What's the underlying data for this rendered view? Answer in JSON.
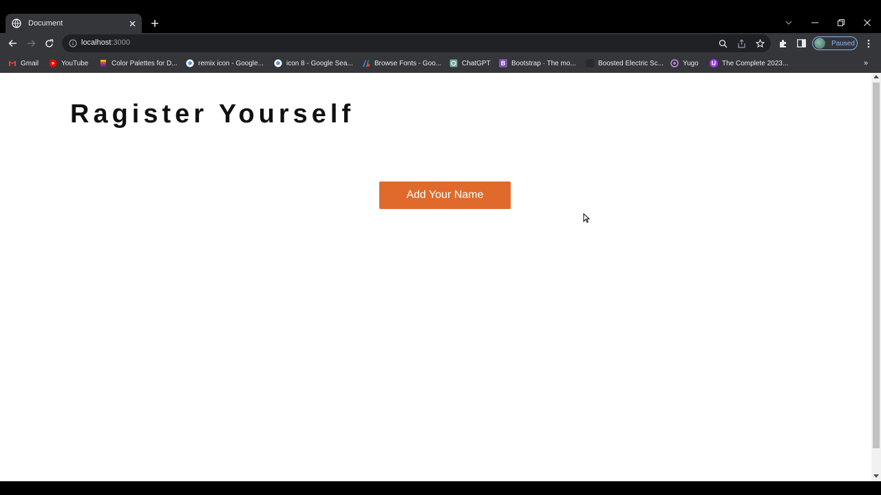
{
  "browser": {
    "tab": {
      "title": "Document",
      "favicon": "globe-icon"
    },
    "address": {
      "host": "localhost",
      "port": ":3000"
    },
    "profile": {
      "status": "Paused"
    },
    "bookmarks": [
      {
        "label": "Gmail",
        "icon": "gmail-icon",
        "color": "#ea4335"
      },
      {
        "label": "YouTube",
        "icon": "youtube-icon",
        "color": "#ff0000"
      },
      {
        "label": "Color Palettes for D...",
        "icon": "palette-icon",
        "color": "#f4b400"
      },
      {
        "label": "remix icon - Google...",
        "icon": "google-icon",
        "color": "#ffffff"
      },
      {
        "label": "icon 8 - Google Sea...",
        "icon": "google-icon",
        "color": "#ffffff"
      },
      {
        "label": "Browse Fonts - Goo...",
        "icon": "fonts-icon",
        "color": "#4285f4"
      },
      {
        "label": "ChatGPT",
        "icon": "chatgpt-icon",
        "color": "#74aa9c"
      },
      {
        "label": "Bootstrap · The mo...",
        "icon": "bootstrap-icon",
        "color": "#7952b3"
      },
      {
        "label": "Boosted Electric Sc...",
        "icon": "boosted-icon",
        "color": "#222222"
      },
      {
        "label": "Yugo",
        "icon": "yugo-icon",
        "color": "#c58af9"
      },
      {
        "label": "The Complete 2023...",
        "icon": "udemy-icon",
        "color": "#a435f0"
      }
    ]
  },
  "page": {
    "heading": "Ragister Yourself",
    "add_button_label": "Add Your Name",
    "accent_color": "#e06a2b"
  }
}
